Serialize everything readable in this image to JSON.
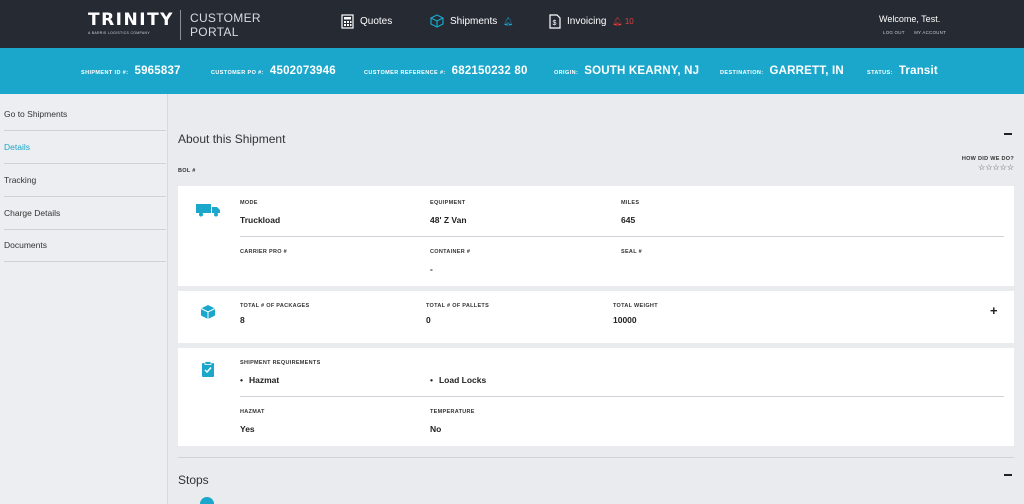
{
  "app": {
    "logo": "TRINITY",
    "logo_sub": "A BARRIS LOGISTICS COMPANY",
    "portal_line1": "CUSTOMER",
    "portal_line2": "PORTAL"
  },
  "nav": {
    "quotes": "Quotes",
    "shipments": "Shipments",
    "invoicing": "Invoicing",
    "invoicing_badge": "10",
    "welcome": "Welcome, Test.",
    "logout": "LOG OUT",
    "my_account": "MY ACCOUNT"
  },
  "shipment": {
    "id_label": "SHIPMENT ID #:",
    "id": "5965837",
    "po_label": "CUSTOMER PO #:",
    "po": "4502073946",
    "ref_label": "CUSTOMER REFERENCE #:",
    "ref": "682150232 80",
    "origin_label": "ORIGIN:",
    "origin": "SOUTH KEARNY, NJ",
    "dest_label": "DESTINATION:",
    "dest": "GARRETT, IN",
    "status_label": "STATUS:",
    "status": "Transit"
  },
  "sidebar": {
    "items": [
      {
        "label": "Go to Shipments"
      },
      {
        "label": "Details"
      },
      {
        "label": "Tracking"
      },
      {
        "label": "Charge Details"
      },
      {
        "label": "Documents"
      }
    ]
  },
  "about": {
    "title": "About this Shipment",
    "bol_label": "BOL #",
    "rating_label": "HOW DID WE DO?",
    "stars": "☆☆☆☆☆"
  },
  "card1": {
    "mode_label": "MODE",
    "mode": "Truckload",
    "equipment_label": "EQUIPMENT",
    "equipment": "48' Z Van",
    "miles_label": "MILES",
    "miles": "645",
    "carrier_label": "CARRIER PRO #",
    "container_label": "CONTAINER #",
    "container": "-",
    "seal_label": "SEAL #"
  },
  "card2": {
    "packages_label": "TOTAL # OF PACKAGES",
    "packages": "8",
    "pallets_label": "TOTAL # OF PALLETS",
    "pallets": "0",
    "weight_label": "TOTAL WEIGHT",
    "weight": "10000"
  },
  "card3": {
    "req_label": "SHIPMENT REQUIREMENTS",
    "req1": "Hazmat",
    "req2": "Load Locks",
    "hazmat_label": "HAZMAT",
    "hazmat": "Yes",
    "temp_label": "TEMPERATURE",
    "temp": "No"
  },
  "stops": {
    "title": "Stops"
  },
  "colors": {
    "accent": "#1aa7cb",
    "topbar": "#262a33"
  }
}
